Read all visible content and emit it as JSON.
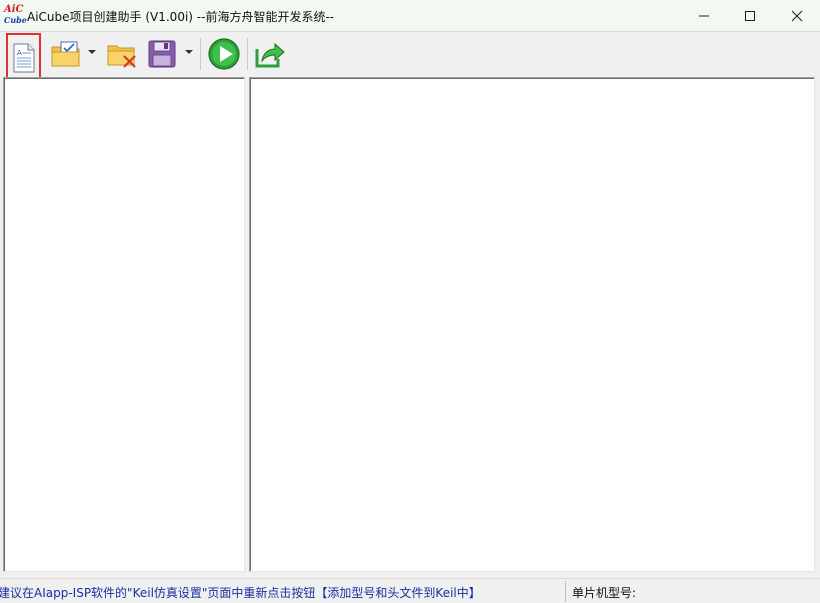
{
  "window": {
    "logo_line1": "AiC",
    "logo_line2": "Cube",
    "title": "AiCube项目创建助手 (V1.00i) --前海方舟智能开发系统--"
  },
  "window_controls": [
    "minimize-icon",
    "maximize-icon",
    "close-icon"
  ],
  "toolbar": {
    "buttons": [
      {
        "name": "new-project",
        "icon": "new-document-icon",
        "selected": true
      },
      {
        "name": "open-project",
        "icon": "open-folder-check-icon",
        "has_dropdown": true
      },
      {
        "name": "close-project",
        "icon": "folder-delete-icon"
      },
      {
        "name": "save-project",
        "icon": "floppy-disk-icon",
        "has_dropdown": true
      },
      {
        "name": "run",
        "icon": "green-play-icon"
      },
      {
        "name": "export",
        "icon": "green-share-arrow-icon"
      }
    ],
    "selected_highlight_color": "#e0322b"
  },
  "statusbar": {
    "message": "建议在AIapp-ISP软件的\"Keil仿真设置\"页面中重新点击按钮【添加型号和头文件到Keil中】",
    "mcu_model_label": "单片机型号:",
    "mcu_model_value": ""
  },
  "colors": {
    "status_message": "#1a2fa0",
    "title_bar": "#f3f8f3",
    "window_bg": "#f0f0f0"
  }
}
